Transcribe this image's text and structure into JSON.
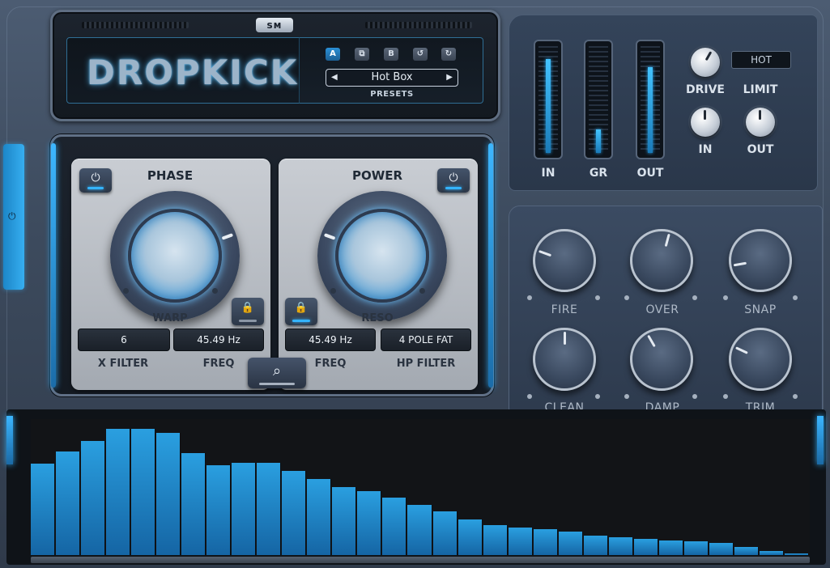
{
  "header": {
    "logo": "sᴍ",
    "title": "DROPKICK",
    "preset_buttons": [
      "A",
      "⧉",
      "B",
      "↺",
      "↻"
    ],
    "preset_name": "Hot Box",
    "presets_label": "PRESETS",
    "prev_glyph": "◀",
    "next_glyph": "▶"
  },
  "side_power": {
    "icon": "⏻"
  },
  "meters": [
    {
      "label": "IN",
      "level": 0.88
    },
    {
      "label": "GR",
      "level": 0.22
    },
    {
      "label": "OUT",
      "level": 0.8
    }
  ],
  "limiter": {
    "mode_value": "HOT",
    "drive_label": "DRIVE",
    "limit_label": "LIMIT",
    "in_label": "IN",
    "out_label": "OUT"
  },
  "phase_section": {
    "title": "PHASE",
    "knob_label": "WARP",
    "x_filter_value": "6",
    "freq_value": "45.49 Hz",
    "x_filter_label": "X FILTER",
    "freq_label": "FREQ",
    "power_icon": "⏻",
    "lock_icon": "🔒"
  },
  "power_section": {
    "title": "POWER",
    "knob_label": "RESO",
    "freq_value": "45.49 Hz",
    "hp_filter_value": "4 POLE FAT",
    "freq_label": "FREQ",
    "hp_filter_label": "HP FILTER",
    "power_icon": "⏻",
    "lock_icon": "🔒"
  },
  "search": {
    "icon": "⌕"
  },
  "knob_bank": [
    {
      "label": "FIRE",
      "angle": -70
    },
    {
      "label": "OVER",
      "angle": 15
    },
    {
      "label": "SNAP",
      "angle": -100
    },
    {
      "label": "CLEAN",
      "angle": 0
    },
    {
      "label": "DAMP",
      "angle": -30
    },
    {
      "label": "TRIM",
      "angle": -65
    }
  ],
  "colors": {
    "accent": "#2a9fe0",
    "panel": "#3d4b5e",
    "screen": "#121922"
  },
  "spectrum": {
    "levels": [
      0.67,
      0.76,
      0.84,
      0.93,
      0.93,
      0.9,
      0.75,
      0.66,
      0.68,
      0.68,
      0.62,
      0.56,
      0.5,
      0.47,
      0.42,
      0.37,
      0.32,
      0.26,
      0.22,
      0.2,
      0.19,
      0.17,
      0.14,
      0.13,
      0.12,
      0.11,
      0.1,
      0.09,
      0.06,
      0.03,
      0.01
    ]
  }
}
